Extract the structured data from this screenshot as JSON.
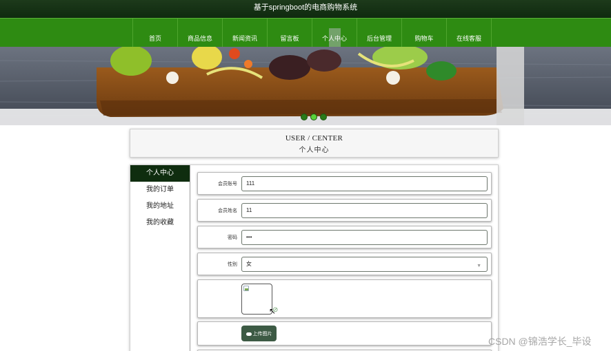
{
  "site": {
    "title": "基于springboot的电商购物系统"
  },
  "nav": {
    "items": [
      {
        "label": "首页",
        "active": false
      },
      {
        "label": "商品信息",
        "active": false
      },
      {
        "label": "新闻资讯",
        "active": false
      },
      {
        "label": "留言板",
        "active": false
      },
      {
        "label": "个人中心",
        "active": true
      },
      {
        "label": "后台管理",
        "active": false
      },
      {
        "label": "购物车",
        "active": false
      },
      {
        "label": "在线客服",
        "active": false
      }
    ]
  },
  "banner": {
    "slides": 3,
    "active_slide": 2
  },
  "section": {
    "title_en": "USER / CENTER",
    "title_cn": "个人中心"
  },
  "sidebar": {
    "items": [
      {
        "label": "个人中心",
        "active": true
      },
      {
        "label": "我的订单",
        "active": false
      },
      {
        "label": "我的地址",
        "active": false
      },
      {
        "label": "我的收藏",
        "active": false
      }
    ]
  },
  "form": {
    "account_label": "会员账号",
    "account_value": "111",
    "name_label": "会员姓名",
    "name_value": "11",
    "password_label": "密码",
    "password_value": "•••",
    "gender_label": "性别",
    "gender_value": "女",
    "upload_label": "上传图片"
  },
  "watermark": "CSDN @锦浩学长_毕设",
  "colors": {
    "nav_green": "#2e8b12",
    "topbar": "#1d3a1b",
    "sidebar_active": "#0f2d0f",
    "upload_button": "#3c5a44"
  }
}
